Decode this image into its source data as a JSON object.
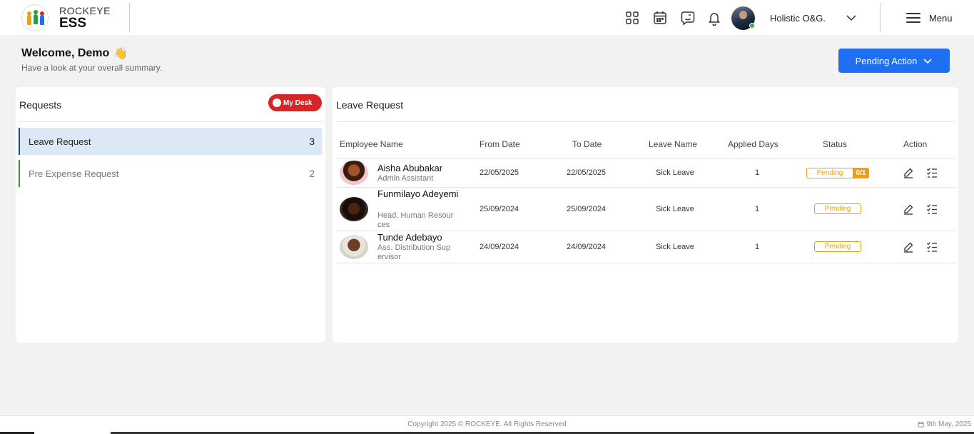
{
  "header": {
    "brand_top": "ROCKEYE",
    "brand_bottom": "ESS",
    "icons": [
      "apps-grid-icon",
      "calendar-icon",
      "chat-icon",
      "bell-icon"
    ],
    "company": "Holistic O&G.",
    "menu_label": "Menu"
  },
  "welcome": {
    "title": "Welcome, Demo",
    "emoji": "👋",
    "subtitle": "Have a look at your overall summary.",
    "pending_action": "Pending Action"
  },
  "requests": {
    "title": "Requests",
    "toggle_label": "My Desk",
    "items": [
      {
        "label": "Leave Request",
        "count": "3",
        "active": true
      },
      {
        "label": "Pre Expense Request",
        "count": "2",
        "active": false
      }
    ]
  },
  "leave": {
    "title": "Leave Request",
    "columns": [
      "Employee Name",
      "From Date",
      "To Date",
      "Leave Name",
      "Applied Days",
      "Status",
      "Action"
    ],
    "rows": [
      {
        "name": "Aisha Abubakar",
        "role": "Admin Assistant",
        "from": "22/05/2025",
        "to": "22/05/2025",
        "leave": "Sick Leave",
        "days": "1",
        "status": "Pending",
        "progress": "0/1"
      },
      {
        "name": "Funmilayo Adeyemi",
        "role": "Head, Human Resources",
        "from": "25/09/2024",
        "to": "25/09/2024",
        "leave": "Sick Leave",
        "days": "1",
        "status": "Pending"
      },
      {
        "name": "Tunde Adebayo",
        "role": "Ass. Distribution Supervisor",
        "from": "24/09/2024",
        "to": "24/09/2024",
        "leave": "Sick Leave",
        "days": "1",
        "status": "Pending"
      }
    ]
  },
  "footer": {
    "copyright": "Copyright 2025 © ROCKEYE. All Rights Reserved",
    "date": "9th May, 2025"
  },
  "colors": {
    "primary": "#1f6ff2",
    "toggle": "#d32626",
    "pending": "#f39c12",
    "active_bg": "#dde8f6",
    "active_border": "#1a49a8",
    "inactive_border": "#27a03a"
  }
}
